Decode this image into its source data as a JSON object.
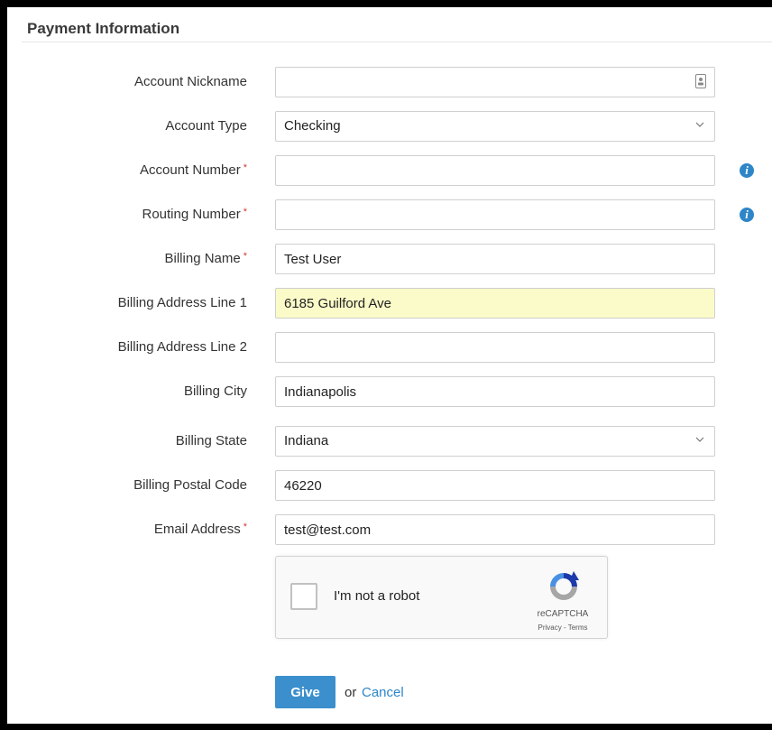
{
  "section": {
    "title": "Payment Information"
  },
  "form": {
    "required_marker": "*",
    "account_nickname": {
      "label": "Account Nickname",
      "value": ""
    },
    "account_type": {
      "label": "Account Type",
      "value": "Checking"
    },
    "account_number": {
      "label": "Account Number",
      "value": ""
    },
    "routing_number": {
      "label": "Routing Number",
      "value": ""
    },
    "billing_name": {
      "label": "Billing Name",
      "value": "Test User"
    },
    "billing_address_1": {
      "label": "Billing Address Line 1",
      "value": "6185 Guilford Ave"
    },
    "billing_address_2": {
      "label": "Billing Address Line 2",
      "value": ""
    },
    "billing_city": {
      "label": "Billing City",
      "value": "Indianapolis"
    },
    "billing_state": {
      "label": "Billing State",
      "value": "Indiana"
    },
    "billing_postal_code": {
      "label": "Billing Postal Code",
      "value": "46220"
    },
    "email_address": {
      "label": "Email Address",
      "value": "test@test.com"
    }
  },
  "icons": {
    "info": "info-icon",
    "info_glyph": "i",
    "contact_card": "contact-card-icon",
    "chevron": "chevron-down-icon"
  },
  "captcha": {
    "label": "I'm not a robot",
    "brand": "reCAPTCHA",
    "links": "Privacy - Terms"
  },
  "actions": {
    "give_label": "Give",
    "or_text": "or",
    "cancel_label": "Cancel"
  },
  "colors": {
    "accent": "#3b8fcc",
    "required": "#d23b3b",
    "autofill_highlight": "#fbfbc9"
  }
}
